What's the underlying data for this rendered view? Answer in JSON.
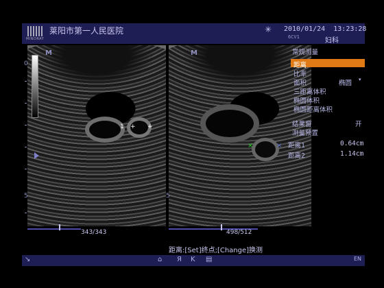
{
  "header": {
    "hospital": "莱阳市第一人民医院",
    "logo_brand": "MINDRAY",
    "date": "2010/01/24",
    "time": "13:23:28",
    "probe": "6CV1",
    "exam": "妇科"
  },
  "image": {
    "left_m_logo": "M",
    "right_m_logo": "M",
    "depth_top": "0",
    "depth_bottom": "5",
    "depth_bottom_right": "5",
    "caliper_label": "1",
    "caliper_plus": "+",
    "caliper_plus2": "+",
    "green_marker": "×",
    "blue_marker": "×"
  },
  "cine": {
    "left_frame": "343/343",
    "right_frame": "498/512"
  },
  "menu": {
    "title": "常规测量",
    "items": [
      "距离",
      "比率",
      "面积",
      "三距离体积",
      "椭圆体积",
      "椭圆距离体积"
    ],
    "area_value": "椭圆",
    "result_window_label": "结果窗",
    "result_window_value": "开",
    "measure_preset": "测量预置",
    "results": [
      {
        "label": "距离1",
        "value": "0.64cm"
      },
      {
        "label": "距离2",
        "value": "1.14cm"
      }
    ]
  },
  "status_text": "距离:[Set]终点;[Change]换测",
  "footer": {
    "arrow_icon": "↘",
    "probe_icon": "⌂",
    "r1": "Я",
    "r2": "K",
    "doc_icon": "▤",
    "lang": "EN"
  },
  "colors": {
    "header_bg": "#1e1e55",
    "menu_highlight": "#e07a14",
    "green_marker": "#2cd02c",
    "blue_marker": "#5b7ad8"
  }
}
